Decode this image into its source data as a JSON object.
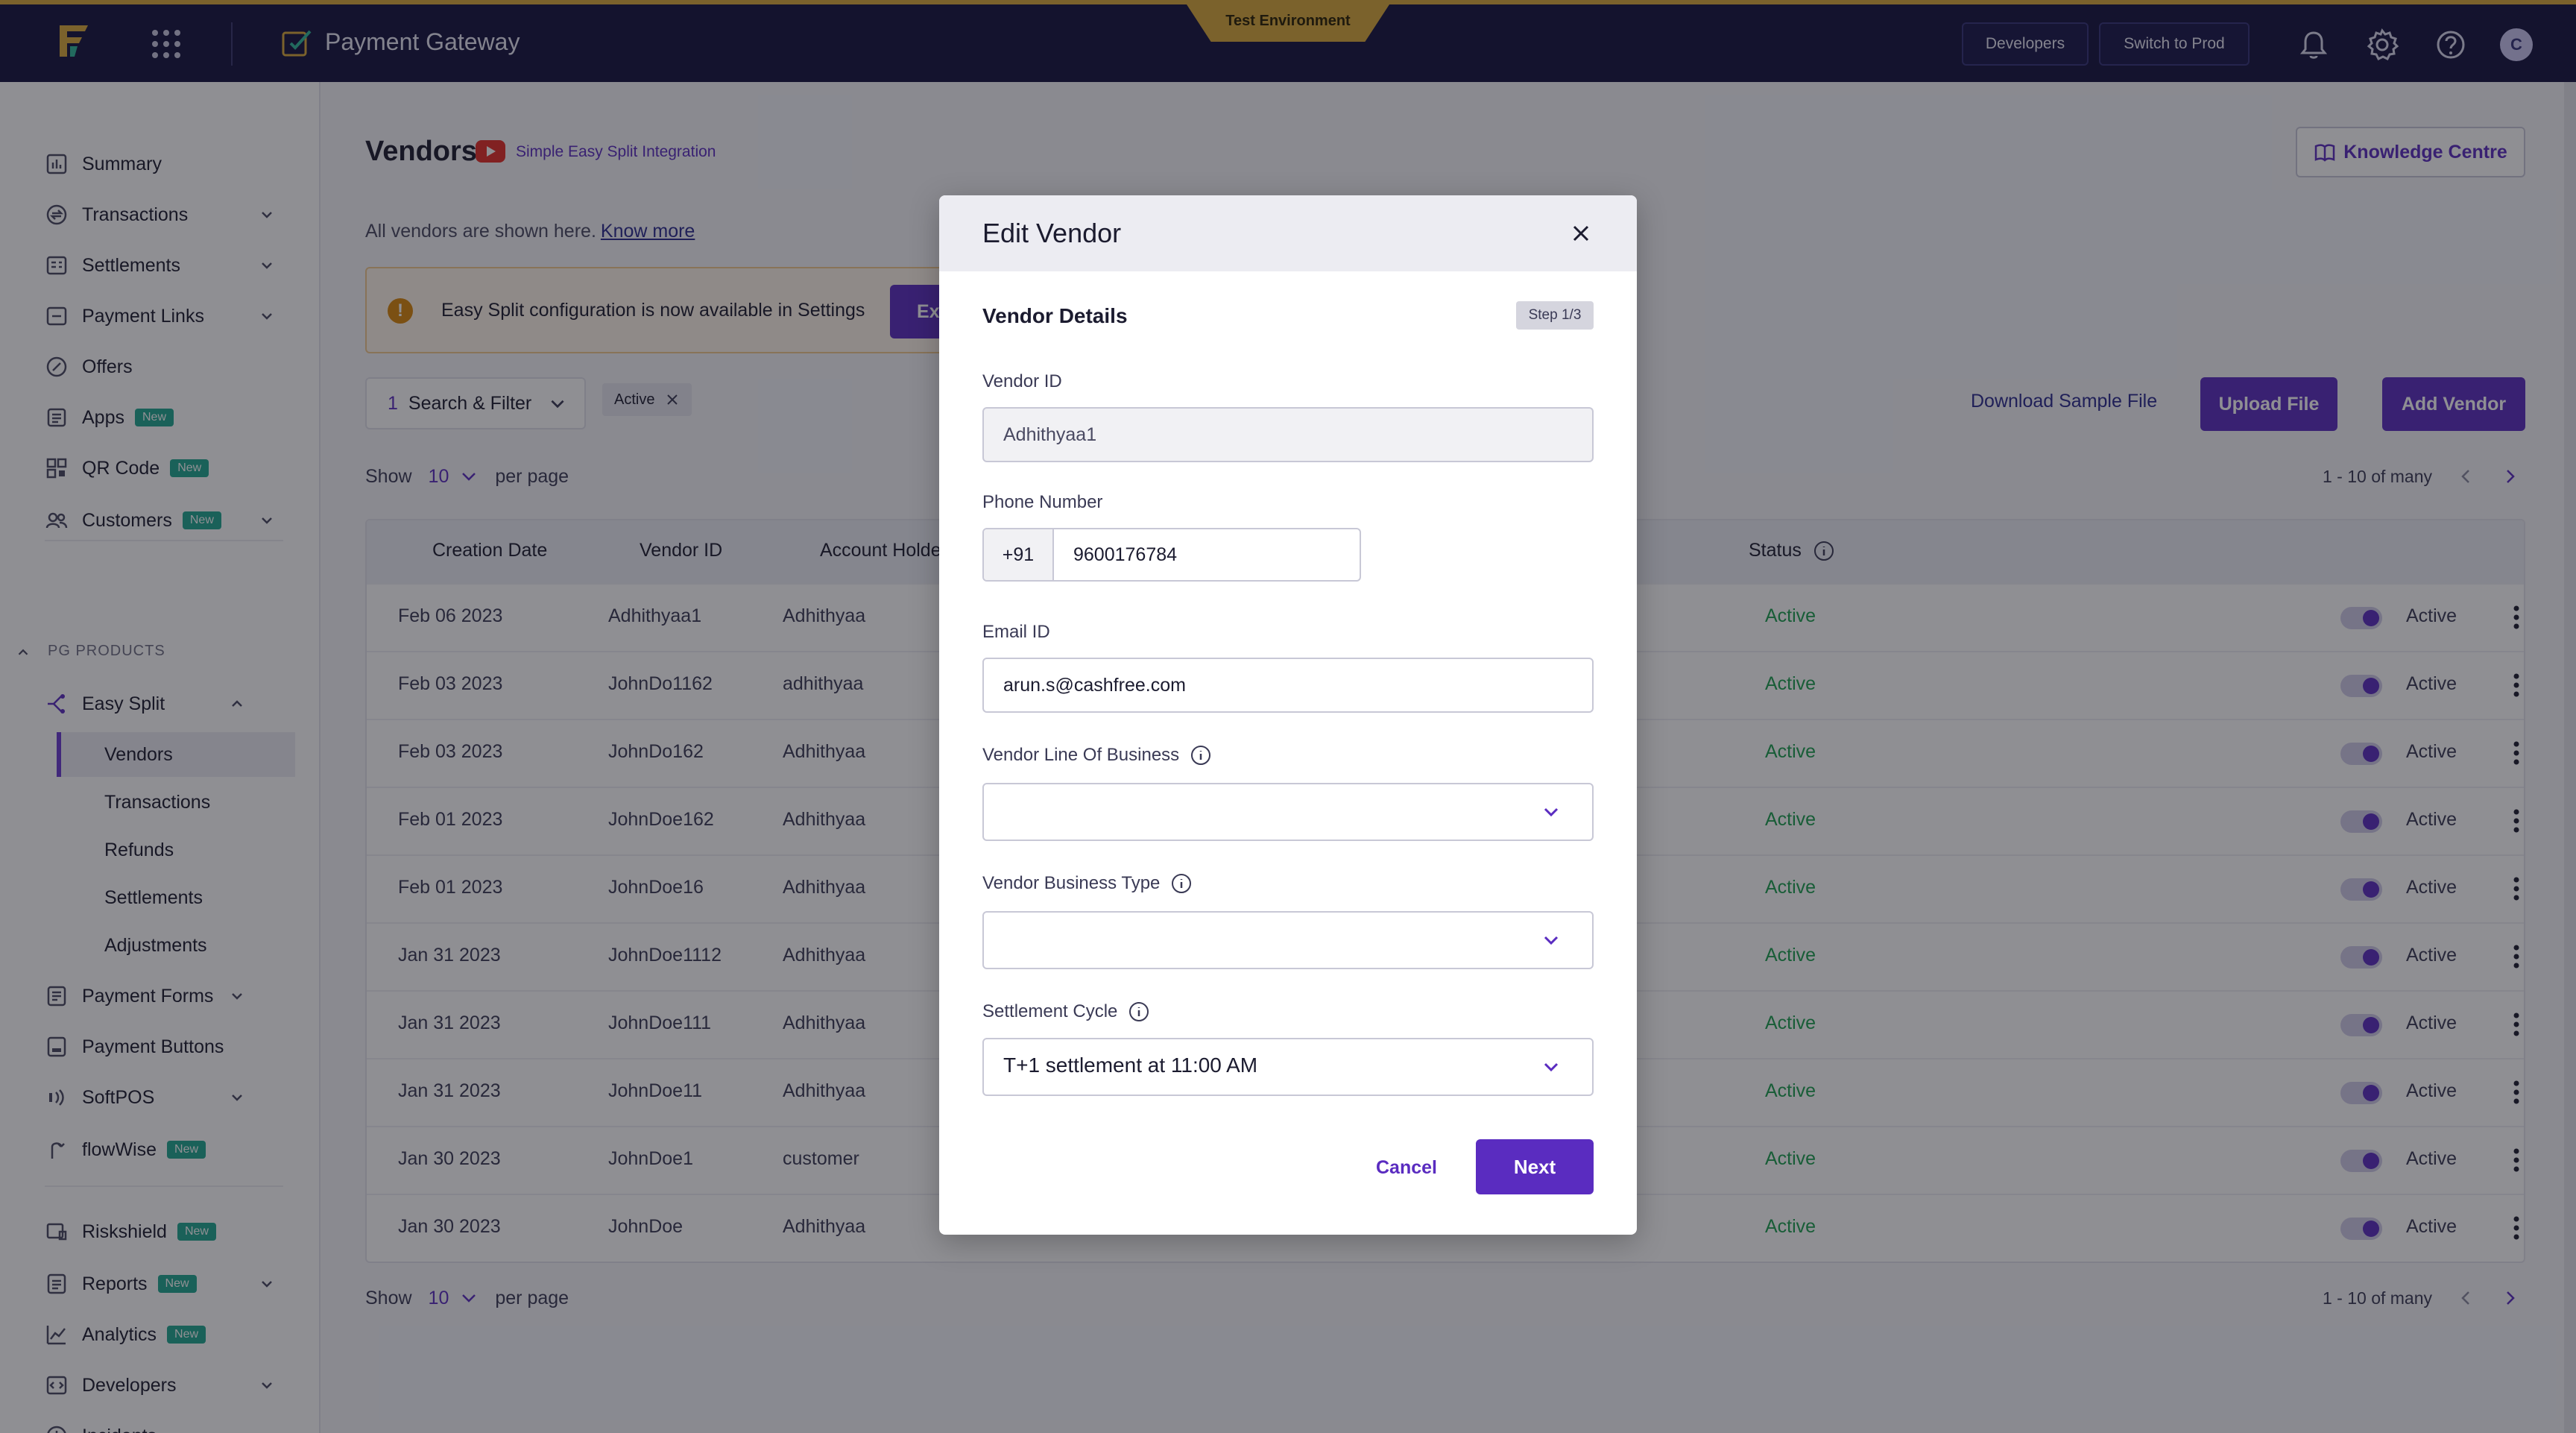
{
  "topbar": {
    "app_title": "Payment Gateway",
    "environment": "Test Environment",
    "developers_label": "Developers",
    "switch_label": "Switch to Prod",
    "avatar_initial": "C",
    "accent": "#d8a93a"
  },
  "sidebar": {
    "items": [
      {
        "label": "Summary",
        "icon": "chart-icon"
      },
      {
        "label": "Transactions",
        "icon": "transactions-icon"
      },
      {
        "label": "Settlements",
        "icon": "settlements-icon"
      },
      {
        "label": "Payment Links",
        "icon": "link-icon"
      },
      {
        "label": "Offers",
        "icon": "offer-icon"
      },
      {
        "label": "Apps",
        "icon": "apps-icon",
        "badge": "New"
      },
      {
        "label": "QR Code",
        "icon": "qr-icon",
        "badge": "New"
      },
      {
        "label": "Customers",
        "icon": "customers-icon",
        "badge": "New"
      }
    ],
    "section_label": "PG PRODUCTS",
    "easy_split": {
      "label": "Easy Split",
      "sub_items": [
        "Vendors",
        "Transactions",
        "Refunds",
        "Settlements",
        "Adjustments"
      ]
    },
    "products": [
      {
        "label": "Payment Forms"
      },
      {
        "label": "Payment Buttons"
      },
      {
        "label": "SoftPOS"
      },
      {
        "label": "flowWise",
        "badge": "New"
      }
    ],
    "bottom": [
      {
        "label": "Riskshield",
        "badge": "New"
      },
      {
        "label": "Reports",
        "badge": "New"
      },
      {
        "label": "Analytics",
        "badge": "New"
      },
      {
        "label": "Developers"
      },
      {
        "label": "Incidents"
      }
    ]
  },
  "page": {
    "title": "Vendors",
    "video_link": "Simple Easy Split Integration",
    "knowledge_centre": "Knowledge Centre",
    "description": "All vendors are shown here.",
    "know_more": "Know more",
    "banner_text": "Easy Split configuration is now available in Settings",
    "banner_button": "Ex",
    "filter_count": "1",
    "filter_label": "Search & Filter",
    "active_chip": "Active",
    "download_sample": "Download Sample File",
    "upload_file": "Upload File",
    "add_vendor": "Add Vendor",
    "show_label": "Show",
    "per_page_value": "10",
    "per_page_label": "per page",
    "range": "1 - 10 of many"
  },
  "table": {
    "columns": [
      "Creation Date",
      "Vendor ID",
      "Account Holde",
      "Status"
    ],
    "rows": [
      {
        "date": "Feb 06 2023",
        "vendor_id": "Adhithyaa1",
        "holder": "Adhithyaa",
        "status": "Active",
        "toggle_label": "Active"
      },
      {
        "date": "Feb 03 2023",
        "vendor_id": "JohnDo1162",
        "holder": "adhithyaa",
        "status": "Active",
        "toggle_label": "Active"
      },
      {
        "date": "Feb 03 2023",
        "vendor_id": "JohnDo162",
        "holder": "Adhithyaa",
        "status": "Active",
        "toggle_label": "Active"
      },
      {
        "date": "Feb 01 2023",
        "vendor_id": "JohnDoe162",
        "holder": "Adhithyaa",
        "status": "Active",
        "toggle_label": "Active"
      },
      {
        "date": "Feb 01 2023",
        "vendor_id": "JohnDoe16",
        "holder": "Adhithyaa",
        "status": "Active",
        "toggle_label": "Active"
      },
      {
        "date": "Jan 31 2023",
        "vendor_id": "JohnDoe1112",
        "holder": "Adhithyaa",
        "status": "Active",
        "toggle_label": "Active"
      },
      {
        "date": "Jan 31 2023",
        "vendor_id": "JohnDoe111",
        "holder": "Adhithyaa",
        "status": "Active",
        "toggle_label": "Active"
      },
      {
        "date": "Jan 31 2023",
        "vendor_id": "JohnDoe11",
        "holder": "Adhithyaa",
        "status": "Active",
        "toggle_label": "Active"
      },
      {
        "date": "Jan 30 2023",
        "vendor_id": "JohnDoe1",
        "holder": "customer",
        "status": "Active",
        "toggle_label": "Active"
      },
      {
        "date": "Jan 30 2023",
        "vendor_id": "JohnDoe",
        "holder": "Adhithyaa",
        "status": "Active",
        "toggle_label": "Active"
      }
    ]
  },
  "modal": {
    "title": "Edit Vendor",
    "section": "Vendor Details",
    "step": "Step 1/3",
    "vendor_id_label": "Vendor ID",
    "vendor_id_value": "Adhithyaa1",
    "phone_label": "Phone Number",
    "phone_code": "+91",
    "phone_value": "9600176784",
    "email_label": "Email ID",
    "email_value": "arun.s@cashfree.com",
    "lob_label": "Vendor Line Of Business",
    "lob_value": "",
    "btype_label": "Vendor Business Type",
    "btype_value": "",
    "cycle_label": "Settlement Cycle",
    "cycle_value": "T+1 settlement at 11:00 AM",
    "cancel": "Cancel",
    "next": "Next",
    "primary_color": "#5a2cc0"
  }
}
